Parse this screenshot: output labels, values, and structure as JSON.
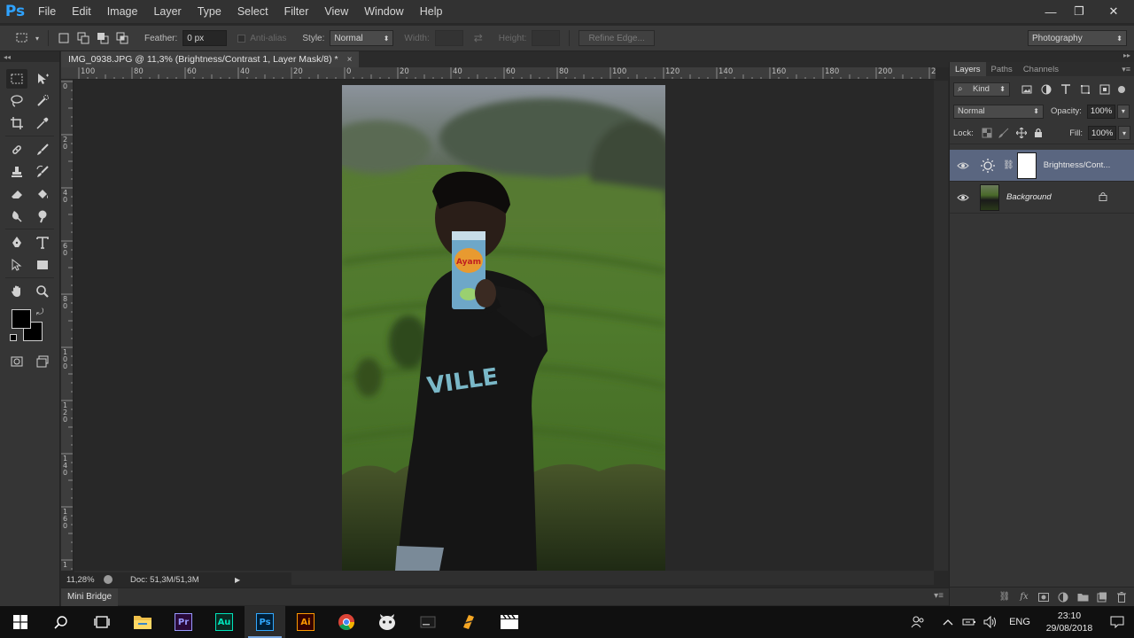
{
  "app": {
    "logo": "Ps",
    "name": "Adobe Photoshop"
  },
  "menu": [
    "File",
    "Edit",
    "Image",
    "Layer",
    "Type",
    "Select",
    "Filter",
    "View",
    "Window",
    "Help"
  ],
  "window_controls": {
    "minimize": "—",
    "restore": "❐",
    "close": "✕"
  },
  "options_bar": {
    "feather_label": "Feather:",
    "feather_value": "0 px",
    "antialias_label": "Anti-alias",
    "style_label": "Style:",
    "style_value": "Normal",
    "width_label": "Width:",
    "height_label": "Height:",
    "refine_edge": "Refine Edge...",
    "workspace": "Photography"
  },
  "document": {
    "tab_title": "IMG_0938.JPG @ 11,3% (Brightness/Contrast 1, Layer Mask/8) *",
    "close": "×"
  },
  "ruler_top": [
    "100",
    "80",
    "60",
    "40",
    "20",
    "0",
    "20",
    "40",
    "60",
    "80",
    "100",
    "120",
    "140",
    "160",
    "180",
    "200",
    "2"
  ],
  "ruler_left": [
    "0",
    "2 0",
    "4 0",
    "6 0",
    "8 0",
    "1 0 0",
    "1 2 0",
    "1 4 0",
    "1 6 0",
    "1"
  ],
  "status": {
    "zoom": "11,28%",
    "doc_info": "Doc: 51,3M/51,3M",
    "arrow": "▶"
  },
  "mini_bridge": {
    "label": "Mini Bridge"
  },
  "layers_panel": {
    "tabs": [
      "Layers",
      "Paths",
      "Channels"
    ],
    "filter_kind": "Kind",
    "blend_mode": "Normal",
    "opacity_label": "Opacity:",
    "opacity_value": "100%",
    "lock_label": "Lock:",
    "fill_label": "Fill:",
    "fill_value": "100%",
    "layers": [
      {
        "name": "Brightness/Cont...",
        "type": "adjustment",
        "selected": true
      },
      {
        "name": "Background",
        "type": "pixel",
        "selected": false,
        "locked": true
      }
    ]
  },
  "taskbar": {
    "apps": [
      {
        "name": "file-explorer",
        "glyph": ""
      },
      {
        "name": "premiere-pro",
        "glyph": "Pr",
        "color": "#9999ff",
        "bg": "#2a0a3a"
      },
      {
        "name": "audition",
        "glyph": "Au",
        "color": "#00e4bb",
        "bg": "#0a2a22"
      },
      {
        "name": "photoshop",
        "glyph": "Ps",
        "color": "#31a8ff",
        "bg": "#001e36",
        "active": true
      },
      {
        "name": "illustrator",
        "glyph": "Ai",
        "color": "#ff9a00",
        "bg": "#330000"
      },
      {
        "name": "chrome",
        "glyph": ""
      },
      {
        "name": "app-mascot",
        "glyph": ""
      },
      {
        "name": "app-dark",
        "glyph": ""
      },
      {
        "name": "app-fl",
        "glyph": ""
      },
      {
        "name": "app-clapper",
        "glyph": ""
      }
    ],
    "tray": {
      "language": "ENG",
      "time": "23:10",
      "date": "29/08/2018"
    }
  },
  "colors": {
    "accent_blue": "#2fa3ff",
    "selected_layer": "#5a6680",
    "foreground": "#000000",
    "background": "#000000"
  }
}
